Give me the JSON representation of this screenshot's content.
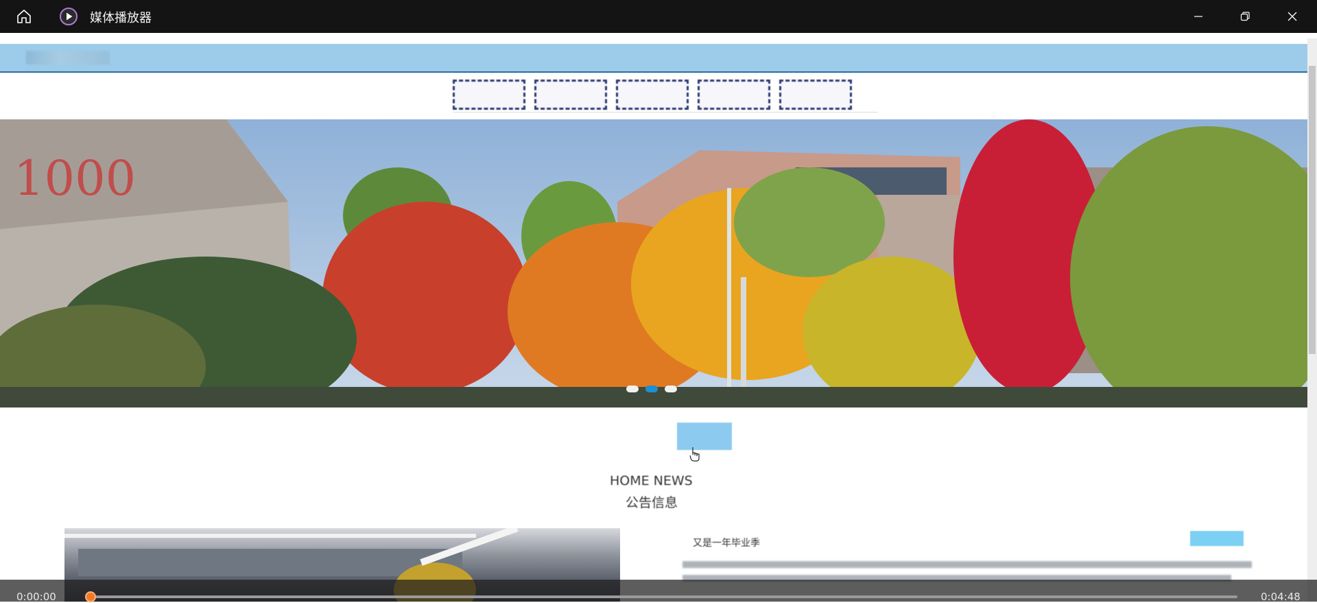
{
  "window": {
    "title": "媒体播放器",
    "icons": {
      "home": "home-icon",
      "app": "play-circle-icon",
      "minimize": "minimize-icon",
      "maximize": "restore-icon",
      "close": "close-icon"
    }
  },
  "player": {
    "current_time": "0:00:00",
    "total_time": "0:04:48",
    "progress": 0,
    "accent_color": "#f07a25"
  },
  "video_frame": {
    "section_heading_en": "HOME NEWS",
    "section_heading_zh": "公告信息",
    "news_title": "又是一年毕业季",
    "carousel_slide_count": 3,
    "carousel_active_index": 1,
    "nav_item_count": 5,
    "colors": {
      "topbar": "#9dcbea",
      "nav_border": "#2f3a73",
      "active_dot": "#1e8fd2",
      "tab_active": "#8ccbef"
    }
  }
}
